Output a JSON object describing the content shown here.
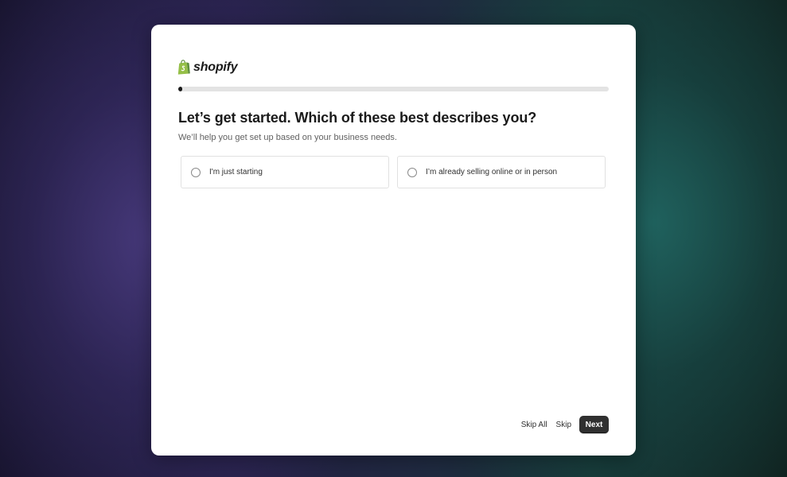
{
  "brand": {
    "name": "shopify",
    "bag_color": "#95bf47",
    "bag_dark_color": "#5e8e3e"
  },
  "progress": {
    "value_percent": 1
  },
  "question": {
    "title": "Let’s get started. Which of these best describes you?",
    "subtitle": "We’ll help you get set up based on your business needs."
  },
  "options": [
    {
      "label": "I'm just starting",
      "selected": false
    },
    {
      "label": "I’m already selling online or in person",
      "selected": false
    }
  ],
  "footer": {
    "skip_all_label": "Skip All",
    "skip_label": "Skip",
    "next_label": "Next"
  },
  "colors": {
    "primary_button": "#303030",
    "progress_fill": "#1a1a1a",
    "progress_track": "#e3e3e3"
  }
}
